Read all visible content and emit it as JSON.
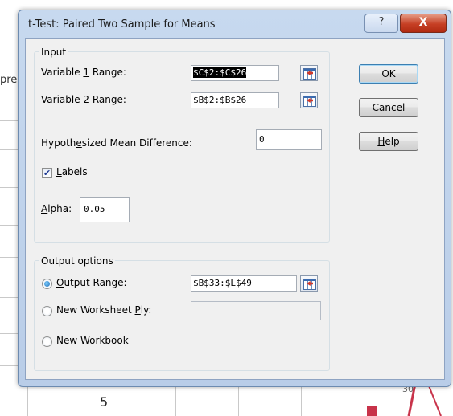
{
  "background": {
    "left_text": "pre",
    "cell_number": "5",
    "cell_number_2": "30"
  },
  "dialog": {
    "title": "t-Test: Paired Two Sample for Means",
    "help_icon": "?",
    "close_icon": "X"
  },
  "input_group": {
    "legend": "Input",
    "var1": {
      "label_pre": "Variable ",
      "label_u": "1",
      "label_post": " Range:",
      "value": "$C$2:$C$26"
    },
    "var2": {
      "label_pre": "Variable ",
      "label_u": "2",
      "label_post": " Range:",
      "value": "$B$2:$B$26"
    },
    "hypo": {
      "label_pre": "Hypoth",
      "label_u": "e",
      "label_post": "sized Mean Difference:",
      "value": "0"
    },
    "labels": {
      "label_u": "L",
      "label_post": "abels",
      "checked": true,
      "check_mark": "✔"
    },
    "alpha": {
      "label_u": "A",
      "label_post": "lpha:",
      "value": "0.05"
    }
  },
  "output_group": {
    "legend": "Output options",
    "output_range": {
      "label_u": "O",
      "label_post": "utput Range:",
      "value": "$B$33:$L$49",
      "selected": true
    },
    "new_ply": {
      "label_pre": "New Worksheet ",
      "label_u": "P",
      "label_post": "ly:",
      "value": "",
      "selected": false
    },
    "new_workbook": {
      "label_pre": "New ",
      "label_u": "W",
      "label_post": "orkbook",
      "selected": false
    }
  },
  "buttons": {
    "ok": "OK",
    "cancel": "Cancel",
    "help_u": "H",
    "help_post": "elp"
  }
}
